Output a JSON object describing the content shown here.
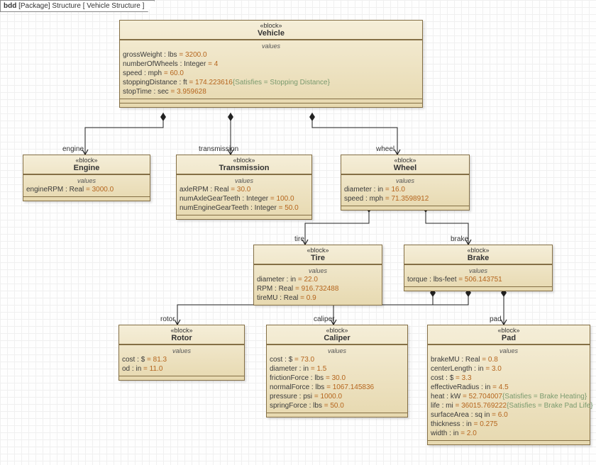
{
  "tab": {
    "prefix": "bdd",
    "scope": "[Package] Structure",
    "name": "[ Vehicle Structure ]"
  },
  "stereotype": "«block»",
  "section_label": "values",
  "blocks": {
    "vehicle": {
      "name": "Vehicle",
      "props": [
        {
          "name": "grossWeight",
          "type": "lbs",
          "value": "3200.0"
        },
        {
          "name": "numberOfWheels",
          "type": "Integer",
          "value": "4"
        },
        {
          "name": "speed",
          "type": "mph",
          "value": "60.0"
        },
        {
          "name": "stoppingDistance",
          "type": "ft",
          "value": "174.223616",
          "constraint": "{Satisfies = Stopping Distance}"
        },
        {
          "name": "stopTime",
          "type": "sec",
          "value": "3.959628"
        }
      ]
    },
    "engine": {
      "name": "Engine",
      "props": [
        {
          "name": "engineRPM",
          "type": "Real",
          "value": "3000.0"
        }
      ]
    },
    "transmission": {
      "name": "Transmission",
      "props": [
        {
          "name": "axleRPM",
          "type": "Real",
          "value": "30.0"
        },
        {
          "name": "numAxleGearTeeth",
          "type": "Integer",
          "value": "100.0"
        },
        {
          "name": "numEngineGearTeeth",
          "type": "Integer",
          "value": "50.0"
        }
      ]
    },
    "wheel": {
      "name": "Wheel",
      "props": [
        {
          "name": "diameter",
          "type": "in",
          "value": "16.0"
        },
        {
          "name": "speed",
          "type": "mph",
          "value": "71.3598912"
        }
      ]
    },
    "tire": {
      "name": "Tire",
      "props": [
        {
          "name": "diameter",
          "type": "in",
          "value": "22.0"
        },
        {
          "name": "RPM",
          "type": "Real",
          "value": "916.732488"
        },
        {
          "name": "tireMU",
          "type": "Real",
          "value": "0.9"
        }
      ]
    },
    "brake": {
      "name": "Brake",
      "props": [
        {
          "name": "torque",
          "type": "lbs-feet",
          "value": "506.143751"
        }
      ]
    },
    "rotor": {
      "name": "Rotor",
      "props": [
        {
          "name": "cost",
          "type": "$",
          "value": "81.3"
        },
        {
          "name": "od",
          "type": "in",
          "value": "11.0"
        }
      ]
    },
    "caliper": {
      "name": "Caliper",
      "props": [
        {
          "name": "cost",
          "type": "$",
          "value": "73.0"
        },
        {
          "name": "diameter",
          "type": "in",
          "value": "1.5"
        },
        {
          "name": "frictionForce",
          "type": "lbs",
          "value": "30.0"
        },
        {
          "name": "normalForce",
          "type": "lbs",
          "value": "1067.145836"
        },
        {
          "name": "pressure",
          "type": "psi",
          "value": "1000.0"
        },
        {
          "name": "springForce",
          "type": "lbs",
          "value": "50.0"
        }
      ]
    },
    "pad": {
      "name": "Pad",
      "props": [
        {
          "name": "brakeMU",
          "type": "Real",
          "value": "0.8"
        },
        {
          "name": "centerLength",
          "type": "in",
          "value": "3.0"
        },
        {
          "name": "cost",
          "type": "$",
          "value": "3.3"
        },
        {
          "name": "effectiveRadius",
          "type": "in",
          "value": "4.5"
        },
        {
          "name": "heat",
          "type": "kW",
          "value": "52.704007",
          "constraint": "{Satisfies = Brake Heating}"
        },
        {
          "name": "life",
          "type": "mi",
          "value": "36015.769222",
          "constraint": "{Satisfies = Brake Pad Life}"
        },
        {
          "name": "surfaceArea",
          "type": "sq in",
          "value": "6.0"
        },
        {
          "name": "thickness",
          "type": "in",
          "value": "0.275"
        },
        {
          "name": "width",
          "type": "in",
          "value": "2.0"
        }
      ]
    }
  },
  "roles": {
    "engine": "engine",
    "transmission": "transmission",
    "wheel": "wheel",
    "tire": "tire",
    "brake": "brake",
    "rotor": "rotor",
    "caliper": "caliper",
    "pad": "pad"
  }
}
